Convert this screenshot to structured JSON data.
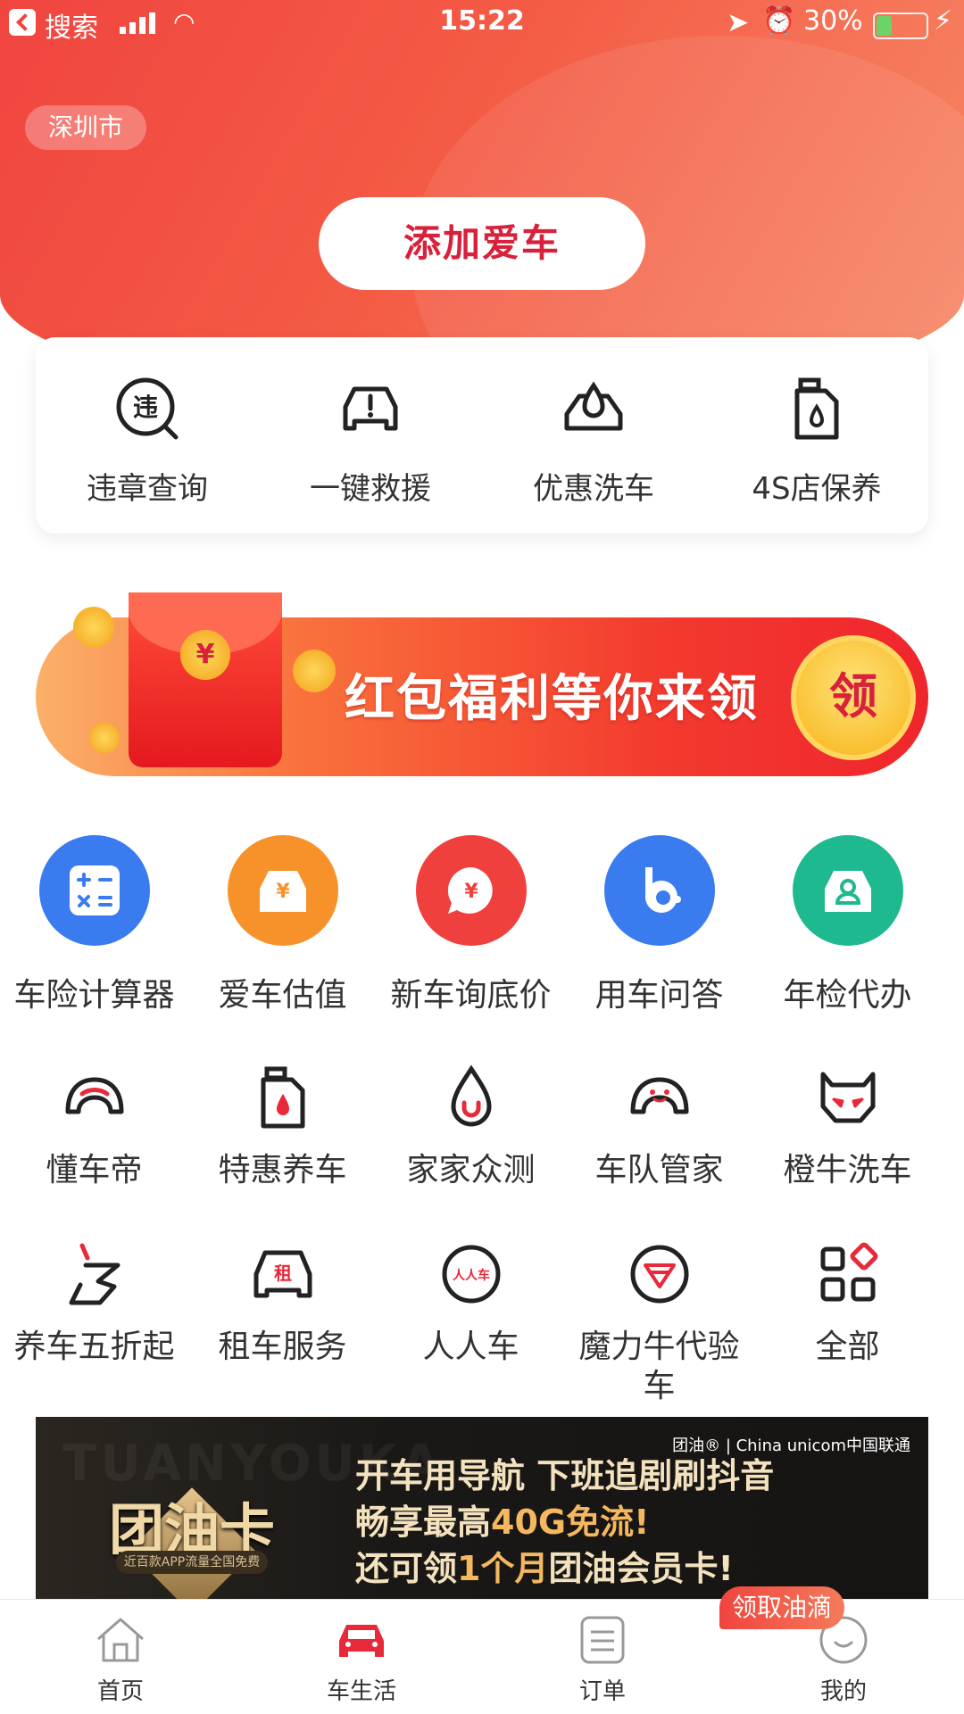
{
  "status_bar": {
    "back_label": "搜索",
    "time": "15:22",
    "battery": "30%",
    "battery_level": 0.3
  },
  "city": "深圳市",
  "add_car_label": "添加爱车",
  "quick_services": [
    {
      "label": "违章查询",
      "icon": "violation-query-icon",
      "glyph": "违"
    },
    {
      "label": "一键救援",
      "icon": "rescue-car-icon"
    },
    {
      "label": "优惠洗车",
      "icon": "car-wash-icon"
    },
    {
      "label": "4S店保养",
      "icon": "oil-can-icon"
    }
  ],
  "red_packet_banner": {
    "text": "红包福利等你来领",
    "button": "领",
    "coin_symbol": "¥"
  },
  "services_row1": [
    {
      "label": "车险计算器",
      "icon": "calculator-icon",
      "color": "#3a7bf0"
    },
    {
      "label": "爱车估值",
      "icon": "car-value-icon",
      "color": "#f7922a",
      "glyph": "¥"
    },
    {
      "label": "新车询底价",
      "icon": "price-chat-icon",
      "color": "#f0403d",
      "glyph": "¥"
    },
    {
      "label": "用车问答",
      "icon": "qa-icon",
      "color": "#3a7bf0"
    },
    {
      "label": "年检代办",
      "icon": "inspection-icon",
      "color": "#1fb98f"
    }
  ],
  "services_row2": [
    {
      "label": "懂车帝",
      "icon": "dongchedi-icon"
    },
    {
      "label": "特惠养车",
      "icon": "maintenance-icon"
    },
    {
      "label": "家家众测",
      "icon": "drop-test-icon"
    },
    {
      "label": "车队管家",
      "icon": "fleet-icon"
    },
    {
      "label": "橙牛洗车",
      "icon": "bull-wash-icon"
    }
  ],
  "services_row3": [
    {
      "label": "养车五折起",
      "icon": "discount-icon"
    },
    {
      "label": "租车服务",
      "icon": "rental-icon",
      "glyph": "租"
    },
    {
      "label": "人人车",
      "icon": "renrenche-icon",
      "glyph": "人人车"
    },
    {
      "label": "魔力牛代验车",
      "icon": "moliniu-icon"
    },
    {
      "label": "全部",
      "icon": "all-apps-icon"
    }
  ],
  "ad_banner": {
    "watermark": "TUANYOUKA",
    "logo_name": "团油卡",
    "logo_sub": "近百款APP流量全国免费",
    "brand": "团油® | China unicom中国联通",
    "line1": "开车用导航 下班追剧刷抖音",
    "line2_pre": "畅享最高",
    "line2_hl": "40G免流!",
    "line3_pre": "还可领",
    "line3_hl": "1个月",
    "line3_post": "团油会员卡!"
  },
  "oil_badge": "领取油滴",
  "tabs": [
    {
      "label": "首页",
      "icon": "home-icon"
    },
    {
      "label": "车生活",
      "icon": "car-life-icon",
      "active": true,
      "color": "#e8293a"
    },
    {
      "label": "订单",
      "icon": "orders-icon"
    },
    {
      "label": "我的",
      "icon": "profile-icon"
    }
  ]
}
